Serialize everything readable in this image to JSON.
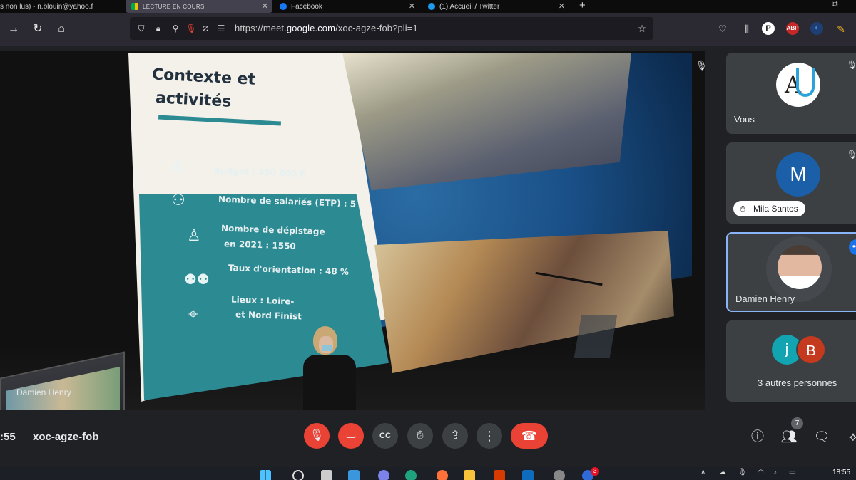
{
  "browser": {
    "tabs": [
      {
        "label": "s non lus) - n.blouin@yahoo.f"
      },
      {
        "label": "LECTURE EN COURS"
      },
      {
        "label": "Facebook"
      },
      {
        "label": "(1) Accueil / Twitter"
      }
    ],
    "url": {
      "prefix": "https://meet.",
      "domain": "google.com",
      "path": "/xoc-agze-fob?pli=1"
    }
  },
  "slide": {
    "title_line1": "Contexte et",
    "title_line2": "activités",
    "items": [
      "Budget : 450 000 €",
      "Nombre de salariés (ETP) : 5",
      "Nombre de dépistage",
      "en 2021 : 1550",
      "Taux d'orientation : 48 %",
      "Lieux : Loire-",
      "et Nord Finist"
    ]
  },
  "main_tile": {
    "name": "Damien Henry"
  },
  "participants": [
    {
      "name": "Vous",
      "avatar_letter": ""
    },
    {
      "name": "Mila Santos",
      "avatar_letter": "M"
    },
    {
      "name": "Damien Henry",
      "avatar_letter": ""
    },
    {
      "name": "3 autres personnes",
      "avatar_letters": [
        "j",
        "B"
      ]
    }
  ],
  "meeting": {
    "time": ":55",
    "code": "xoc-agze-fob",
    "people_count": "7"
  },
  "taskbar": {
    "badge": "3",
    "clock": "18:55"
  },
  "colors": {
    "red": "#ea4335",
    "tile": "#3c4043",
    "background": "#202124",
    "highlight": "#8ab4f8"
  }
}
